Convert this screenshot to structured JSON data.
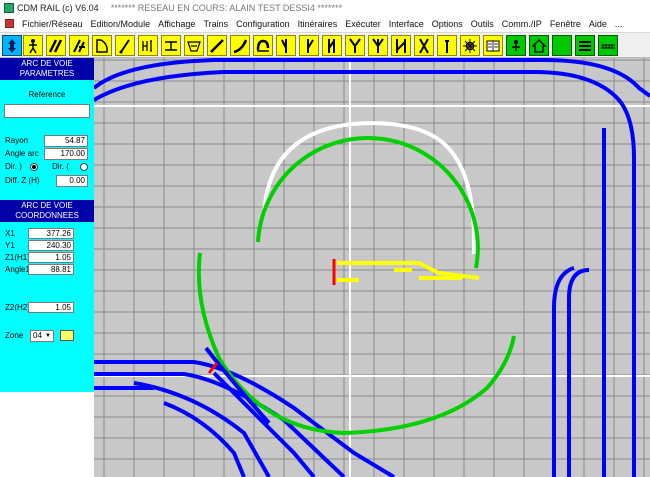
{
  "titlebar": {
    "app_name": "CDM RAIL (c) V6.04",
    "window_title": "******* RESEAU EN COURS: ALAIN TEST DESSI4 *******"
  },
  "menu": {
    "items": [
      "Fichier/Réseau",
      "Edition/Module",
      "Affichage",
      "Trains",
      "Configuration",
      "Itinéraires",
      "Exécuter",
      "Interface",
      "Options",
      "Outils",
      "Comm./IP",
      "Fenêtre",
      "Aide",
      "..."
    ]
  },
  "toolbar": {
    "tools": [
      "move-tool",
      "person-tool",
      "double-track-tool",
      "switch-tool",
      "arc-shape-tool",
      "pointer-tool",
      "height-tool",
      "bridge-tool",
      "basket-tool",
      "straight-tool",
      "curve-tool",
      "loop-tool",
      "turnout-left-tool",
      "turnout-right-tool",
      "double-turnout-tool",
      "wye-tool",
      "three-way-tool",
      "slip-tool",
      "cross-tool",
      "thin-tool",
      "gear-tool",
      "book-tool",
      "green-person-tool",
      "green-house-tool",
      "green-block-tool",
      "lines-tool",
      "ruler-tool"
    ]
  },
  "panel": {
    "params_header": [
      "ARC DE VOIE",
      "PARAMETRES"
    ],
    "reference_label": "Reference",
    "reference_value": "",
    "rayon_label": "Rayon",
    "rayon_value": "54.87",
    "angle_label": "Angle arc",
    "angle_value": "170.00",
    "dir1_label": "Dir. )",
    "dir2_label": "Dir. (",
    "diffz_label": "Diff. Z (H)",
    "diffz_value": "0.00",
    "coords_header": [
      "ARC DE VOIE",
      "COORDONNEES"
    ],
    "x1_label": "X1",
    "x1_value": "377.26",
    "y1_label": "Y1",
    "y1_value": "240.30",
    "z1_label": "Z1(H1)",
    "z1_value": "1.05",
    "angle1_label": "Angle1",
    "angle1_value": "88.81",
    "z2_label": "Z2(H2)",
    "z2_value": "1.05",
    "zone_label": "Zone",
    "zone_value": "04"
  },
  "colors": {
    "track": "#0000ff",
    "selected_arc": "#00d000",
    "grid": "#8a8a8a",
    "panel_bg": "#00ffff",
    "header_bg": "#0000a8",
    "marker": "#ff0000",
    "ghost_switch": "#ffff00"
  }
}
